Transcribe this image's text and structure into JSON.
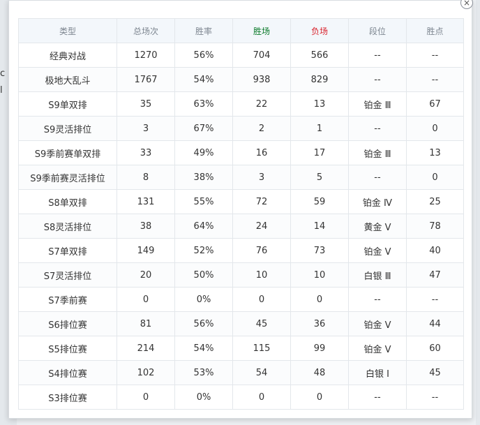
{
  "window": {
    "close_glyph": "×"
  },
  "background_fragments": [
    "c",
    "l"
  ],
  "table": {
    "headers": {
      "type": "类型",
      "total": "总场次",
      "win_rate": "胜率",
      "wins": "胜场",
      "losses": "负场",
      "rank": "段位",
      "points": "胜点"
    },
    "rows": [
      {
        "type": "经典对战",
        "total": "1270",
        "win_rate": "56%",
        "wins": "704",
        "losses": "566",
        "rank": "--",
        "points": "--"
      },
      {
        "type": "极地大乱斗",
        "total": "1767",
        "win_rate": "54%",
        "wins": "938",
        "losses": "829",
        "rank": "--",
        "points": "--"
      },
      {
        "type": "S9单双排",
        "total": "35",
        "win_rate": "63%",
        "wins": "22",
        "losses": "13",
        "rank": "铂金 Ⅲ",
        "points": "67"
      },
      {
        "type": "S9灵活排位",
        "total": "3",
        "win_rate": "67%",
        "wins": "2",
        "losses": "1",
        "rank": "--",
        "points": "0"
      },
      {
        "type": "S9季前赛单双排",
        "total": "33",
        "win_rate": "49%",
        "wins": "16",
        "losses": "17",
        "rank": "铂金 Ⅲ",
        "points": "13"
      },
      {
        "type": "S9季前赛灵活排位",
        "total": "8",
        "win_rate": "38%",
        "wins": "3",
        "losses": "5",
        "rank": "--",
        "points": "0"
      },
      {
        "type": "S8单双排",
        "total": "131",
        "win_rate": "55%",
        "wins": "72",
        "losses": "59",
        "rank": "铂金 Ⅳ",
        "points": "25"
      },
      {
        "type": "S8灵活排位",
        "total": "38",
        "win_rate": "64%",
        "wins": "24",
        "losses": "14",
        "rank": "黄金 Ⅴ",
        "points": "78"
      },
      {
        "type": "S7单双排",
        "total": "149",
        "win_rate": "52%",
        "wins": "76",
        "losses": "73",
        "rank": "铂金 Ⅴ",
        "points": "40"
      },
      {
        "type": "S7灵活排位",
        "total": "20",
        "win_rate": "50%",
        "wins": "10",
        "losses": "10",
        "rank": "白银 Ⅲ",
        "points": "47"
      },
      {
        "type": "S7季前赛",
        "total": "0",
        "win_rate": "0%",
        "wins": "0",
        "losses": "0",
        "rank": "--",
        "points": "--"
      },
      {
        "type": "S6排位赛",
        "total": "81",
        "win_rate": "56%",
        "wins": "45",
        "losses": "36",
        "rank": "铂金 Ⅴ",
        "points": "44"
      },
      {
        "type": "S5排位赛",
        "total": "214",
        "win_rate": "54%",
        "wins": "115",
        "losses": "99",
        "rank": "铂金 Ⅴ",
        "points": "60"
      },
      {
        "type": "S4排位赛",
        "total": "102",
        "win_rate": "53%",
        "wins": "54",
        "losses": "48",
        "rank": "白银 Ⅰ",
        "points": "45"
      },
      {
        "type": "S3排位赛",
        "total": "0",
        "win_rate": "0%",
        "wins": "0",
        "losses": "0",
        "rank": "--",
        "points": "--"
      }
    ]
  },
  "colors": {
    "header_bg": "#f3f7fb",
    "header_text": "#7d8690",
    "wins_header": "#0a7a2a",
    "losses_header": "#d9242e",
    "border": "#e3e7eb"
  }
}
